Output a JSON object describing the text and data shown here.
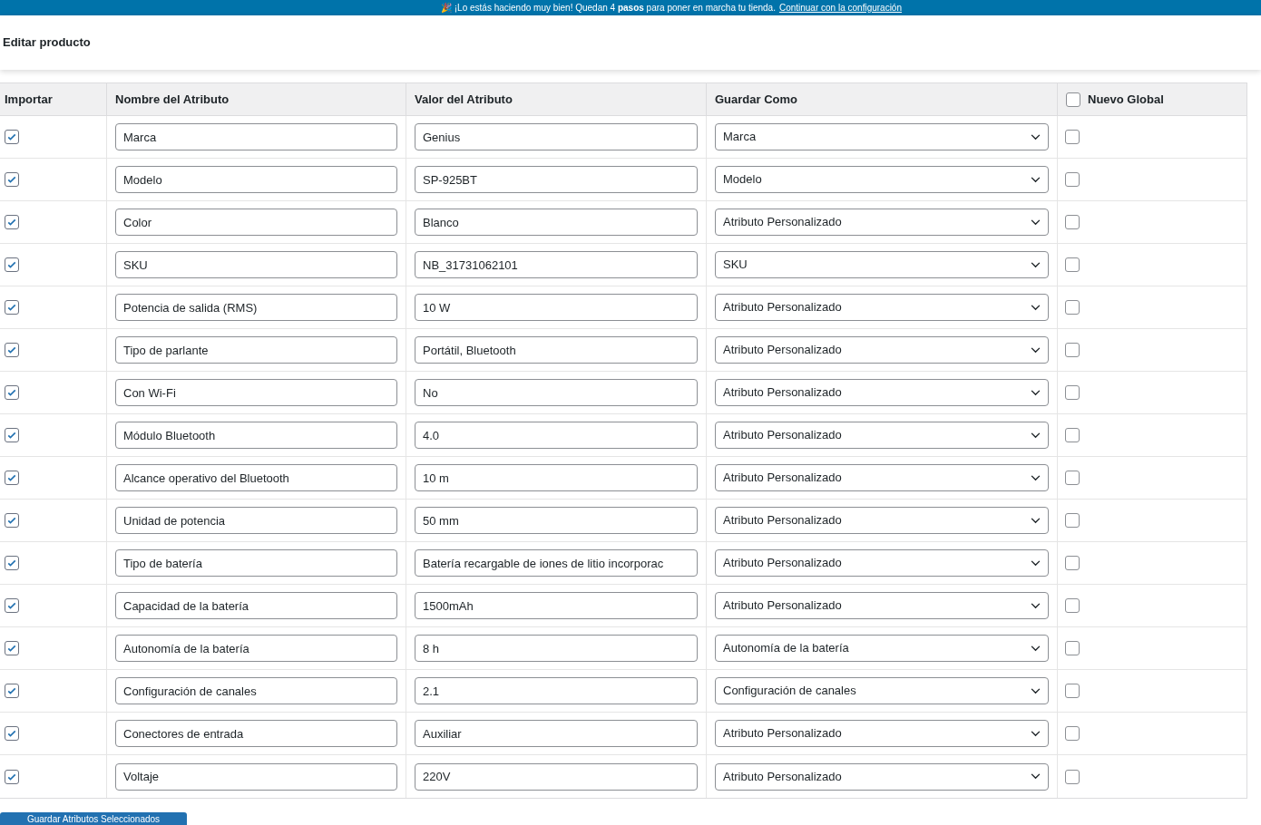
{
  "banner": {
    "text": "🎉 ¡Lo estás haciendo muy bien! Quedan 4 **pasos** para poner en marcha tu tienda.",
    "link": "Continuar con la configuración"
  },
  "page_title": "Editar producto",
  "table": {
    "columns": [
      "Importar",
      "Nombre del Atributo",
      "Valor del Atributo",
      "Guardar Como",
      "Nuevo Global"
    ],
    "new_global_all": false,
    "rows": [
      {
        "import": true,
        "name": "Marca",
        "value": "Genius",
        "save_as": "Marca",
        "new_global": false
      },
      {
        "import": true,
        "name": "Modelo",
        "value": "SP-925BT",
        "save_as": "Modelo",
        "new_global": false
      },
      {
        "import": true,
        "name": "Color",
        "value": "Blanco",
        "save_as": "Atributo Personalizado",
        "new_global": false
      },
      {
        "import": true,
        "name": "SKU",
        "value": "NB_31731062101",
        "save_as": "SKU",
        "new_global": false
      },
      {
        "import": true,
        "name": "Potencia de salida (RMS)",
        "value": "10 W",
        "save_as": "Atributo Personalizado",
        "new_global": false
      },
      {
        "import": true,
        "name": "Tipo de parlante",
        "value": "Portátil, Bluetooth",
        "save_as": "Atributo Personalizado",
        "new_global": false
      },
      {
        "import": true,
        "name": "Con Wi-Fi",
        "value": "No",
        "save_as": "Atributo Personalizado",
        "new_global": false
      },
      {
        "import": true,
        "name": "Módulo Bluetooth",
        "value": "4.0",
        "save_as": "Atributo Personalizado",
        "new_global": false
      },
      {
        "import": true,
        "name": "Alcance operativo del Bluetooth",
        "value": "10 m",
        "save_as": "Atributo Personalizado",
        "new_global": false
      },
      {
        "import": true,
        "name": "Unidad de potencia",
        "value": "50 mm",
        "save_as": "Atributo Personalizado",
        "new_global": false
      },
      {
        "import": true,
        "name": "Tipo de batería",
        "value": "Batería recargable de iones de litio incorporac",
        "save_as": "Atributo Personalizado",
        "new_global": false
      },
      {
        "import": true,
        "name": "Capacidad de la batería",
        "value": "1500mAh",
        "save_as": "Atributo Personalizado",
        "new_global": false
      },
      {
        "import": true,
        "name": "Autonomía de la batería",
        "value": "8 h",
        "save_as": "Autonomía de la batería",
        "new_global": false
      },
      {
        "import": true,
        "name": "Configuración de canales",
        "value": "2.1",
        "save_as": "Configuración de canales",
        "new_global": false
      },
      {
        "import": true,
        "name": "Conectores de entrada",
        "value": "Auxiliar",
        "save_as": "Atributo Personalizado",
        "new_global": false
      },
      {
        "import": true,
        "name": "Voltaje",
        "value": "220V",
        "save_as": "Atributo Personalizado",
        "new_global": false
      }
    ]
  },
  "save_button": "Guardar Atributos Seleccionados"
}
